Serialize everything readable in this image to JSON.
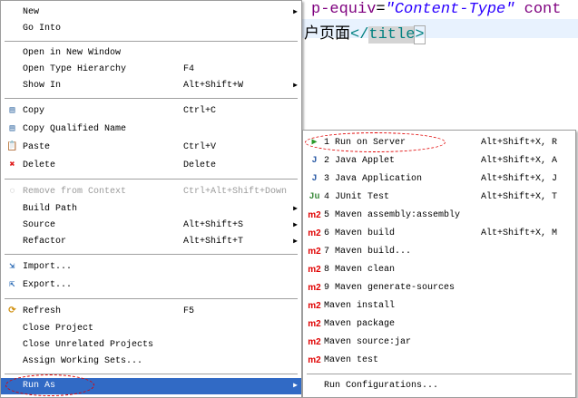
{
  "editor": {
    "line1": {
      "attr": "p-equiv",
      "eq": "=",
      "value": "\"Content-Type\"",
      "rest": " cont"
    },
    "line2": {
      "text": "户页面",
      "open": "</",
      "tag": "title",
      "close": ">"
    }
  },
  "main_menu": [
    {
      "label": "New",
      "arrow": true
    },
    {
      "label": "Go Into"
    },
    {
      "sep": true
    },
    {
      "label": "Open in New Window"
    },
    {
      "label": "Open Type Hierarchy",
      "shortcut": "F4"
    },
    {
      "label": "Show In",
      "shortcut": "Alt+Shift+W",
      "arrow": true
    },
    {
      "sep": true
    },
    {
      "label": "Copy",
      "shortcut": "Ctrl+C",
      "icon": "copy-icon"
    },
    {
      "label": "Copy Qualified Name",
      "icon": "copy-qualified-name-icon"
    },
    {
      "label": "Paste",
      "shortcut": "Ctrl+V",
      "icon": "paste-icon"
    },
    {
      "label": "Delete",
      "shortcut": "Delete",
      "icon": "delete-icon"
    },
    {
      "sep": true
    },
    {
      "label": "Remove from Context",
      "shortcut": "Ctrl+Alt+Shift+Down",
      "icon": "remove-context-icon",
      "disabled": true
    },
    {
      "label": "Build Path",
      "arrow": true
    },
    {
      "label": "Source",
      "shortcut": "Alt+Shift+S",
      "arrow": true
    },
    {
      "label": "Refactor",
      "shortcut": "Alt+Shift+T",
      "arrow": true
    },
    {
      "sep": true
    },
    {
      "label": "Import...",
      "icon": "import-icon"
    },
    {
      "label": "Export...",
      "icon": "export-icon"
    },
    {
      "sep": true
    },
    {
      "label": "Refresh",
      "shortcut": "F5",
      "icon": "refresh-icon"
    },
    {
      "label": "Close Project"
    },
    {
      "label": "Close Unrelated Projects"
    },
    {
      "label": "Assign Working Sets..."
    },
    {
      "sep": true
    },
    {
      "label": "Run As",
      "arrow": true,
      "selected": true
    }
  ],
  "run_as_menu": [
    {
      "label": "1 Run on Server",
      "shortcut": "Alt+Shift+X, R",
      "icon": "server-run-icon"
    },
    {
      "label": "2 Java Applet",
      "shortcut": "Alt+Shift+X, A",
      "icon": "java-applet-icon"
    },
    {
      "label": "3 Java Application",
      "shortcut": "Alt+Shift+X, J",
      "icon": "java-application-icon"
    },
    {
      "label": "4 JUnit Test",
      "shortcut": "Alt+Shift+X, T",
      "icon": "junit-icon"
    },
    {
      "label": "5 Maven assembly:assembly",
      "icon": "maven-icon"
    },
    {
      "label": "6 Maven build",
      "shortcut": "Alt+Shift+X, M",
      "icon": "maven-icon"
    },
    {
      "label": "7 Maven build...",
      "icon": "maven-icon"
    },
    {
      "label": "8 Maven clean",
      "icon": "maven-icon"
    },
    {
      "label": "9 Maven generate-sources",
      "icon": "maven-icon"
    },
    {
      "label": "Maven install",
      "icon": "maven-icon"
    },
    {
      "label": "Maven package",
      "icon": "maven-icon"
    },
    {
      "label": "Maven source:jar",
      "icon": "maven-icon"
    },
    {
      "label": "Maven test",
      "icon": "maven-icon"
    },
    {
      "sep": true
    },
    {
      "label": "Run Configurations..."
    }
  ],
  "colors": {
    "highlight": "#316ac5",
    "annotation": "#e00000"
  }
}
